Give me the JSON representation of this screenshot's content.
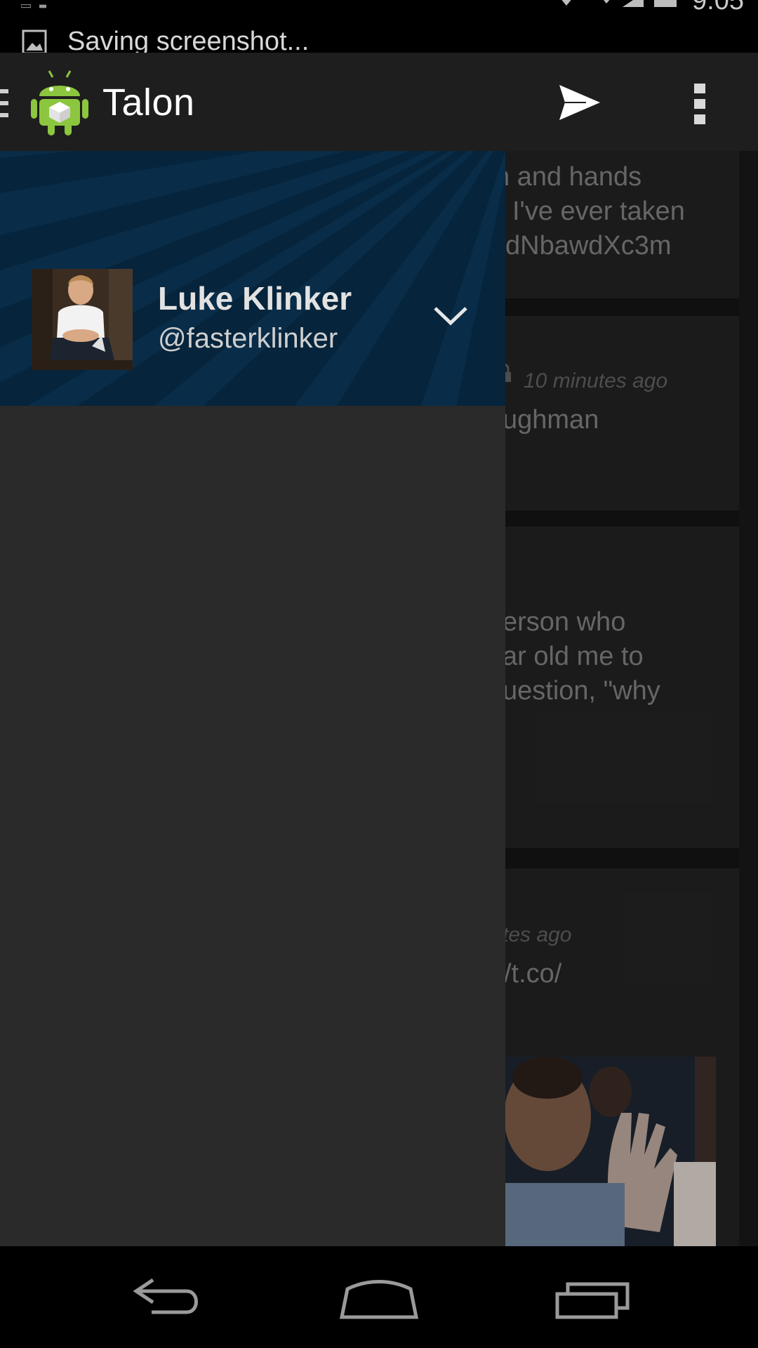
{
  "status_bar": {
    "notification": "Saving screenshot...",
    "time": "9:05"
  },
  "action_bar": {
    "title": "Talon",
    "send_icon": "send-icon",
    "overflow_icon": "overflow-menu-icon",
    "app_icon": "android-robot-icon"
  },
  "drawer": {
    "user_name": "Luke Klinker",
    "user_handle": "@fasterklinker",
    "toggle_icon": "chevron-down-icon"
  },
  "feed": {
    "card1": {
      "line1": "n and hands",
      "line2": "I've ever taken",
      "line3": "dNbawdXc3m"
    },
    "card2": {
      "time": "10 minutes ago",
      "line1": "ughman"
    },
    "card3": {
      "line1": "erson who",
      "line2": "ar old me to",
      "line3": "uestion, \"why"
    },
    "card4": {
      "time": "tes ago",
      "line1": "/t.co/"
    }
  },
  "nav_bar": {
    "back": "back-icon",
    "home": "home-icon",
    "recents": "recent-apps-icon"
  },
  "colors": {
    "drawer_bg": "#2a2a2a",
    "header_bg": "#072740",
    "action_bar_bg": "#1e1e1e"
  }
}
